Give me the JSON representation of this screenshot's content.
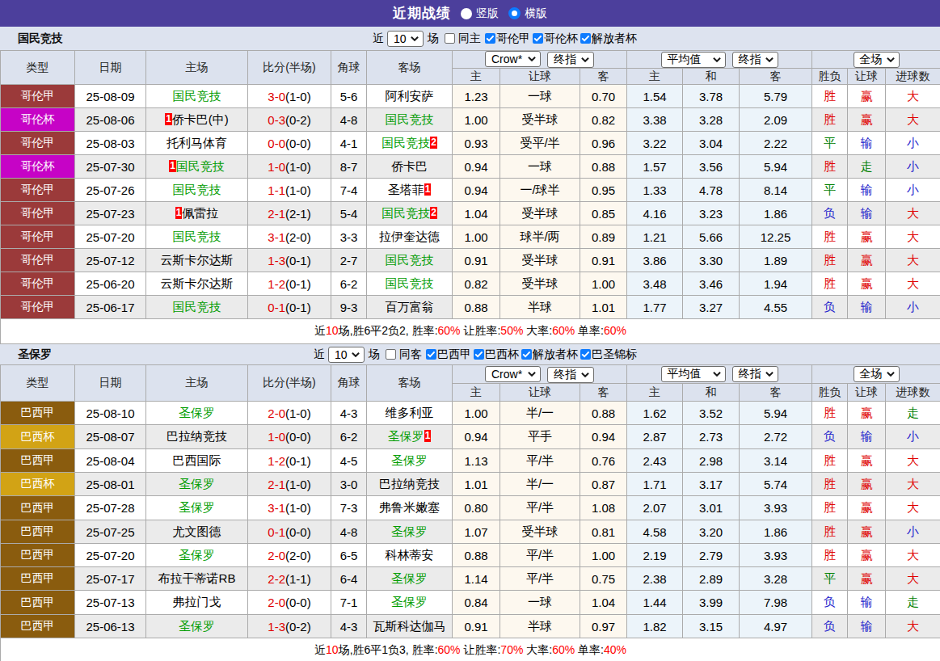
{
  "topbar": {
    "title": "近期战绩",
    "radios": [
      {
        "label": "竖版",
        "checked": false
      },
      {
        "label": "横版",
        "checked": true
      }
    ]
  },
  "filter_labels": {
    "recent_prefix": "近",
    "recent_suffix": "场"
  },
  "table_header": {
    "main_columns": [
      "类型",
      "日期",
      "主场",
      "比分(半场)",
      "角球",
      "客场"
    ],
    "groups": [
      {
        "selects": [
          "Crow*",
          "终指"
        ],
        "columns": [
          "主",
          "让球",
          "客"
        ]
      },
      {
        "selects": [
          "平均值",
          "终指"
        ],
        "columns": [
          "主",
          "和",
          "客"
        ]
      },
      {
        "selects": [
          "全场"
        ],
        "columns": [
          "胜负",
          "让球",
          "进球数"
        ]
      }
    ]
  },
  "colors": {
    "type": {
      "哥伦甲": "#9b3a3a",
      "哥伦杯": "#c603c6",
      "巴西甲": "#8a5c0e",
      "巴西杯": "#d2a315"
    },
    "result": {
      "胜": "#e00000",
      "平": "#008000",
      "负": "#2323cc",
      "赢": "#e00000",
      "输": "#2323cc",
      "走": "#008000",
      "大": "#e00000",
      "小": "#2323cc"
    }
  },
  "sections": [
    {
      "team": "国民竞技",
      "recent_count": "10",
      "same_filter": {
        "label": "同主",
        "checked": false
      },
      "league_filters": [
        {
          "label": "哥伦甲",
          "checked": true
        },
        {
          "label": "哥伦杯",
          "checked": true
        },
        {
          "label": "解放者杯",
          "checked": true
        }
      ],
      "rows": [
        {
          "type": "哥伦甲",
          "date": "25-08-09",
          "home": {
            "name": "国民竞技",
            "green": true
          },
          "score": "3-0",
          "half": "(1-0)",
          "corner": "5-6",
          "away": {
            "name": "阿利安萨"
          },
          "odds": [
            "1.23",
            "一球",
            "0.70"
          ],
          "avg": [
            "1.54",
            "3.78",
            "5.79"
          ],
          "result": [
            "胜",
            "赢",
            "大"
          ]
        },
        {
          "type": "哥伦杯",
          "date": "25-08-06",
          "home": {
            "name": "侨卡巴(中)",
            "card": "1",
            "cardPos": "before"
          },
          "score": "0-3",
          "half": "(0-2)",
          "corner": "4-8",
          "away": {
            "name": "国民竞技",
            "green": true
          },
          "odds": [
            "1.00",
            "受半球",
            "0.82"
          ],
          "avg": [
            "3.38",
            "3.28",
            "2.09"
          ],
          "result": [
            "胜",
            "赢",
            "大"
          ]
        },
        {
          "type": "哥伦甲",
          "date": "25-08-03",
          "home": {
            "name": "托利马体育"
          },
          "score": "0-0",
          "half": "(0-0)",
          "corner": "4-1",
          "away": {
            "name": "国民竞技",
            "green": true,
            "card": "2",
            "cardPos": "after"
          },
          "odds": [
            "0.93",
            "受平/半",
            "0.96"
          ],
          "avg": [
            "3.22",
            "3.04",
            "2.22"
          ],
          "result": [
            "平",
            "输",
            "小"
          ]
        },
        {
          "type": "哥伦杯",
          "date": "25-07-30",
          "home": {
            "name": "国民竞技",
            "green": true,
            "card": "1",
            "cardPos": "before"
          },
          "score": "1-0",
          "half": "(1-0)",
          "corner": "8-7",
          "away": {
            "name": "侨卡巴"
          },
          "odds": [
            "0.94",
            "一球",
            "0.88"
          ],
          "avg": [
            "1.57",
            "3.56",
            "5.94"
          ],
          "result": [
            "胜",
            "走",
            "小"
          ]
        },
        {
          "type": "哥伦甲",
          "date": "25-07-26",
          "home": {
            "name": "国民竞技",
            "green": true
          },
          "score": "1-1",
          "half": "(1-0)",
          "corner": "7-4",
          "away": {
            "name": "圣塔菲",
            "card": "1",
            "cardPos": "after"
          },
          "odds": [
            "0.94",
            "一/球半",
            "0.95"
          ],
          "avg": [
            "1.33",
            "4.78",
            "8.14"
          ],
          "result": [
            "平",
            "输",
            "小"
          ]
        },
        {
          "type": "哥伦甲",
          "date": "25-07-23",
          "home": {
            "name": "佩雷拉",
            "card": "1",
            "cardPos": "before"
          },
          "score": "2-1",
          "half": "(2-1)",
          "corner": "5-4",
          "away": {
            "name": "国民竞技",
            "green": true,
            "card": "2",
            "cardPos": "after"
          },
          "odds": [
            "1.04",
            "受半球",
            "0.85"
          ],
          "avg": [
            "4.16",
            "3.23",
            "1.86"
          ],
          "result": [
            "负",
            "输",
            "大"
          ]
        },
        {
          "type": "哥伦甲",
          "date": "25-07-20",
          "home": {
            "name": "国民竞技",
            "green": true
          },
          "score": "3-1",
          "half": "(2-0)",
          "corner": "3-3",
          "away": {
            "name": "拉伊奎达德"
          },
          "odds": [
            "1.00",
            "球半/两",
            "0.89"
          ],
          "avg": [
            "1.21",
            "5.66",
            "12.25"
          ],
          "result": [
            "胜",
            "赢",
            "大"
          ]
        },
        {
          "type": "哥伦甲",
          "date": "25-07-12",
          "home": {
            "name": "云斯卡尔达斯"
          },
          "score": "1-3",
          "half": "(0-1)",
          "corner": "2-7",
          "away": {
            "name": "国民竞技",
            "green": true
          },
          "odds": [
            "0.91",
            "受半球",
            "0.91"
          ],
          "avg": [
            "3.86",
            "3.30",
            "1.89"
          ],
          "result": [
            "胜",
            "赢",
            "大"
          ]
        },
        {
          "type": "哥伦甲",
          "date": "25-06-20",
          "home": {
            "name": "云斯卡尔达斯"
          },
          "score": "1-2",
          "half": "(0-1)",
          "corner": "6-2",
          "away": {
            "name": "国民竞技",
            "green": true
          },
          "odds": [
            "0.82",
            "受半球",
            "1.00"
          ],
          "avg": [
            "3.48",
            "3.46",
            "1.94"
          ],
          "result": [
            "胜",
            "赢",
            "大"
          ]
        },
        {
          "type": "哥伦甲",
          "date": "25-06-17",
          "home": {
            "name": "国民竞技",
            "green": true
          },
          "score": "0-1",
          "half": "(0-1)",
          "corner": "9-3",
          "away": {
            "name": "百万富翁"
          },
          "odds": [
            "0.88",
            "半球",
            "1.01"
          ],
          "avg": [
            "1.77",
            "3.27",
            "4.55"
          ],
          "result": [
            "负",
            "输",
            "小"
          ]
        }
      ],
      "summary": [
        {
          "t": "近",
          "red": false
        },
        {
          "t": "10",
          "red": true
        },
        {
          "t": "场,胜6平2负2, 胜率:",
          "red": false
        },
        {
          "t": "60%",
          "red": true
        },
        {
          "t": " 让胜率:",
          "red": false
        },
        {
          "t": "50%",
          "red": true
        },
        {
          "t": " 大率:",
          "red": false
        },
        {
          "t": "60%",
          "red": true
        },
        {
          "t": " 单率:",
          "red": false
        },
        {
          "t": "60%",
          "red": true
        }
      ]
    },
    {
      "team": "圣保罗",
      "recent_count": "10",
      "same_filter": {
        "label": "同客",
        "checked": false
      },
      "league_filters": [
        {
          "label": "巴西甲",
          "checked": true
        },
        {
          "label": "巴西杯",
          "checked": true
        },
        {
          "label": "解放者杯",
          "checked": true
        },
        {
          "label": "巴圣锦标",
          "checked": true
        }
      ],
      "rows": [
        {
          "type": "巴西甲",
          "date": "25-08-10",
          "home": {
            "name": "圣保罗",
            "green": true
          },
          "score": "2-0",
          "half": "(1-0)",
          "corner": "4-3",
          "away": {
            "name": "维多利亚"
          },
          "odds": [
            "1.00",
            "半/一",
            "0.88"
          ],
          "avg": [
            "1.62",
            "3.52",
            "5.94"
          ],
          "result": [
            "胜",
            "赢",
            "走"
          ]
        },
        {
          "type": "巴西杯",
          "date": "25-08-07",
          "home": {
            "name": "巴拉纳竞技"
          },
          "score": "1-0",
          "half": "(0-0)",
          "corner": "6-2",
          "away": {
            "name": "圣保罗",
            "green": true,
            "card": "1",
            "cardPos": "after"
          },
          "odds": [
            "0.94",
            "平手",
            "0.94"
          ],
          "avg": [
            "2.87",
            "2.73",
            "2.72"
          ],
          "result": [
            "负",
            "输",
            "小"
          ]
        },
        {
          "type": "巴西甲",
          "date": "25-08-04",
          "home": {
            "name": "巴西国际"
          },
          "score": "1-2",
          "half": "(0-1)",
          "corner": "4-5",
          "away": {
            "name": "圣保罗",
            "green": true
          },
          "odds": [
            "1.13",
            "平/半",
            "0.76"
          ],
          "avg": [
            "2.43",
            "2.98",
            "3.14"
          ],
          "result": [
            "胜",
            "赢",
            "大"
          ]
        },
        {
          "type": "巴西杯",
          "date": "25-08-01",
          "home": {
            "name": "圣保罗",
            "green": true
          },
          "score": "2-1",
          "half": "(1-0)",
          "corner": "3-0",
          "away": {
            "name": "巴拉纳竞技"
          },
          "odds": [
            "1.01",
            "半/一",
            "0.87"
          ],
          "avg": [
            "1.71",
            "3.17",
            "5.74"
          ],
          "result": [
            "胜",
            "赢",
            "大"
          ]
        },
        {
          "type": "巴西甲",
          "date": "25-07-28",
          "home": {
            "name": "圣保罗",
            "green": true
          },
          "score": "3-1",
          "half": "(1-0)",
          "corner": "7-3",
          "away": {
            "name": "弗鲁米嫩塞"
          },
          "odds": [
            "0.80",
            "平/半",
            "1.08"
          ],
          "avg": [
            "2.07",
            "3.01",
            "3.93"
          ],
          "result": [
            "胜",
            "赢",
            "大"
          ]
        },
        {
          "type": "巴西甲",
          "date": "25-07-25",
          "home": {
            "name": "尤文图德"
          },
          "score": "0-1",
          "half": "(0-0)",
          "corner": "4-8",
          "away": {
            "name": "圣保罗",
            "green": true
          },
          "odds": [
            "1.07",
            "受半球",
            "0.81"
          ],
          "avg": [
            "4.58",
            "3.20",
            "1.86"
          ],
          "result": [
            "胜",
            "赢",
            "小"
          ]
        },
        {
          "type": "巴西甲",
          "date": "25-07-20",
          "home": {
            "name": "圣保罗",
            "green": true
          },
          "score": "2-0",
          "half": "(2-0)",
          "corner": "6-5",
          "away": {
            "name": "科林蒂安"
          },
          "odds": [
            "0.88",
            "平/半",
            "1.00"
          ],
          "avg": [
            "2.19",
            "2.79",
            "3.93"
          ],
          "result": [
            "胜",
            "赢",
            "大"
          ]
        },
        {
          "type": "巴西甲",
          "date": "25-07-17",
          "home": {
            "name": "布拉干蒂诺RB"
          },
          "score": "2-2",
          "half": "(1-1)",
          "corner": "6-4",
          "away": {
            "name": "圣保罗",
            "green": true
          },
          "odds": [
            "1.14",
            "平/半",
            "0.75"
          ],
          "avg": [
            "2.38",
            "2.89",
            "3.28"
          ],
          "result": [
            "平",
            "赢",
            "大"
          ]
        },
        {
          "type": "巴西甲",
          "date": "25-07-13",
          "home": {
            "name": "弗拉门戈"
          },
          "score": "2-0",
          "half": "(0-0)",
          "corner": "7-1",
          "away": {
            "name": "圣保罗",
            "green": true
          },
          "odds": [
            "0.84",
            "一球",
            "1.04"
          ],
          "avg": [
            "1.44",
            "3.99",
            "7.98"
          ],
          "result": [
            "负",
            "输",
            "走"
          ]
        },
        {
          "type": "巴西甲",
          "date": "25-06-13",
          "home": {
            "name": "圣保罗",
            "green": true
          },
          "score": "1-3",
          "half": "(0-2)",
          "corner": "4-3",
          "away": {
            "name": "瓦斯科达伽马"
          },
          "odds": [
            "0.91",
            "半球",
            "0.97"
          ],
          "avg": [
            "1.82",
            "3.15",
            "4.97"
          ],
          "result": [
            "负",
            "输",
            "大"
          ]
        }
      ],
      "summary": [
        {
          "t": "近",
          "red": false
        },
        {
          "t": "10",
          "red": true
        },
        {
          "t": "场,胜6平1负3, 胜率:",
          "red": false
        },
        {
          "t": "60%",
          "red": true
        },
        {
          "t": " 让胜率:",
          "red": false
        },
        {
          "t": "70%",
          "red": true
        },
        {
          "t": " 大率:",
          "red": false
        },
        {
          "t": "60%",
          "red": true
        },
        {
          "t": " 单率:",
          "red": false
        },
        {
          "t": "40%",
          "red": true
        }
      ]
    }
  ]
}
